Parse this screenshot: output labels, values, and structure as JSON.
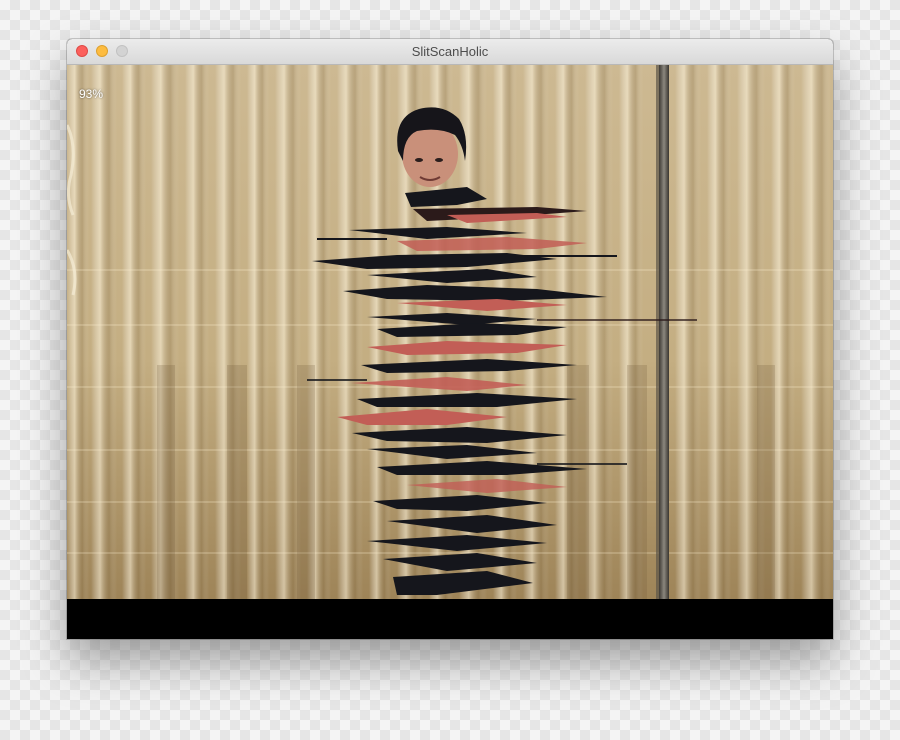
{
  "window": {
    "title": "SlitScanHolic",
    "controls": [
      "close-button",
      "minimize-button",
      "zoom-button"
    ]
  },
  "overlay": {
    "progress_label": "93%",
    "progress_value": 0.93
  },
  "colors": {
    "curtain": "#c8b48a",
    "curtain_dark": "#8a7350",
    "figure_dark": "#15161c",
    "figure_red": "#c25e56",
    "close": "#fc605c",
    "minimize": "#fdbc40"
  }
}
